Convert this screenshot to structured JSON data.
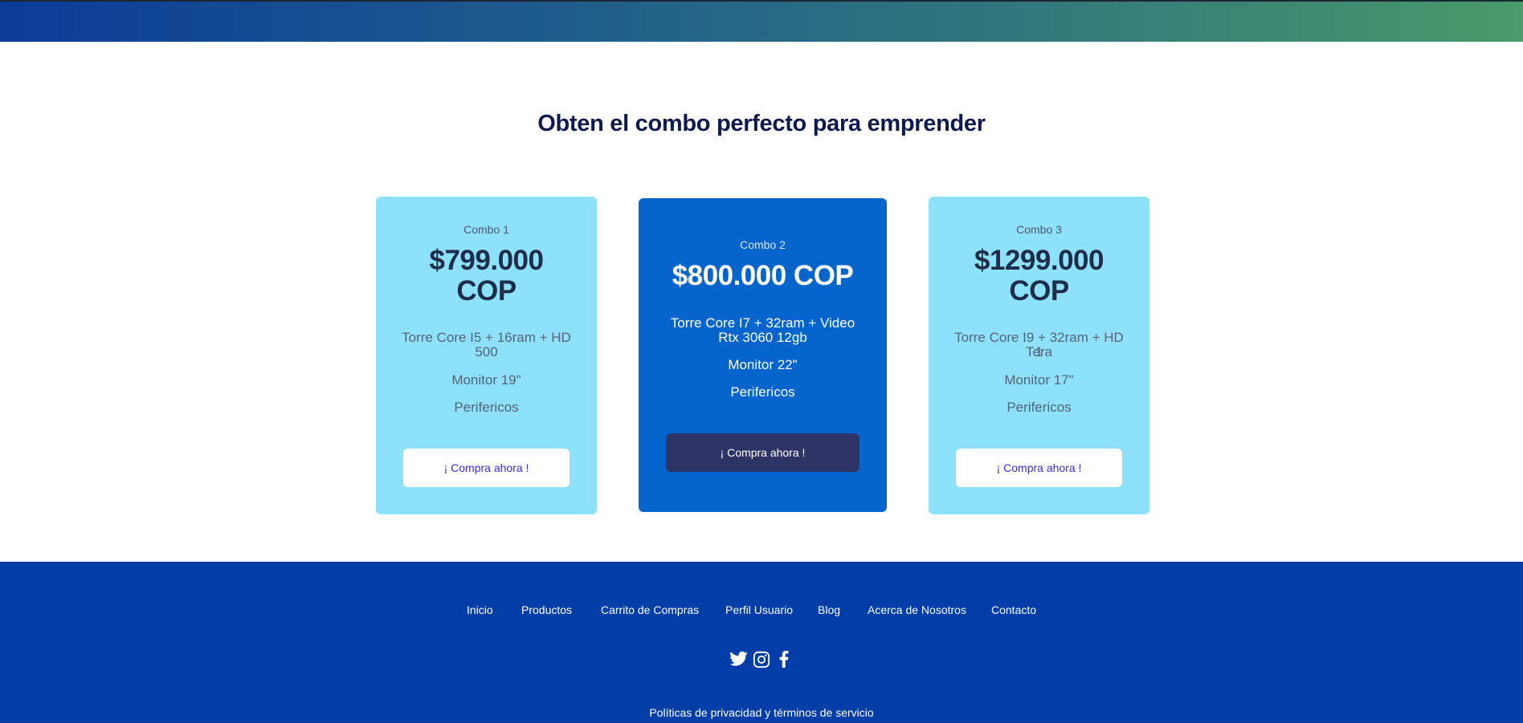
{
  "section": {
    "title": "Obten el combo perfecto para emprender"
  },
  "combos": [
    {
      "name": "Combo 1",
      "price_line1": "$799.000",
      "price_line2": "COP",
      "features": [
        "Torre Core I5 + 16ram + HD",
        "500",
        "Monitor 19\"",
        "Perifericos"
      ],
      "button_label": "¡ Compra ahora !"
    },
    {
      "name": "Combo 2",
      "price": "$800.000 COP",
      "features": [
        "Torre Core I7 + 32ram + Video",
        "Rtx 3060 12gb",
        "Monitor 22\"",
        "Perifericos"
      ],
      "button_label": "¡ Compra ahora !"
    },
    {
      "name": "Combo 3",
      "price_line1": "$1299.000",
      "price_line2": "COP",
      "features": [
        "Torre Core I9 + 32ram + HD 1",
        "Tera",
        "Monitor 17\"",
        "Perifericos"
      ],
      "button_label": "¡ Compra ahora !"
    }
  ],
  "footer": {
    "nav": [
      "Inicio",
      "Productos",
      "Carrito de Compras",
      "Perfil Usuario",
      "Blog",
      "Acerca de Nosotros",
      "Contacto"
    ],
    "social_icons": [
      "twitter-icon",
      "instagram-icon",
      "facebook-icon"
    ],
    "legal": "Políticas de privacidad y términos de servicio"
  },
  "colors": {
    "light_card": "#8ee1fb",
    "featured_card": "#0565cc",
    "featured_button": "#2e3566",
    "footer": "#023ea7",
    "title": "#0e1a4e"
  }
}
